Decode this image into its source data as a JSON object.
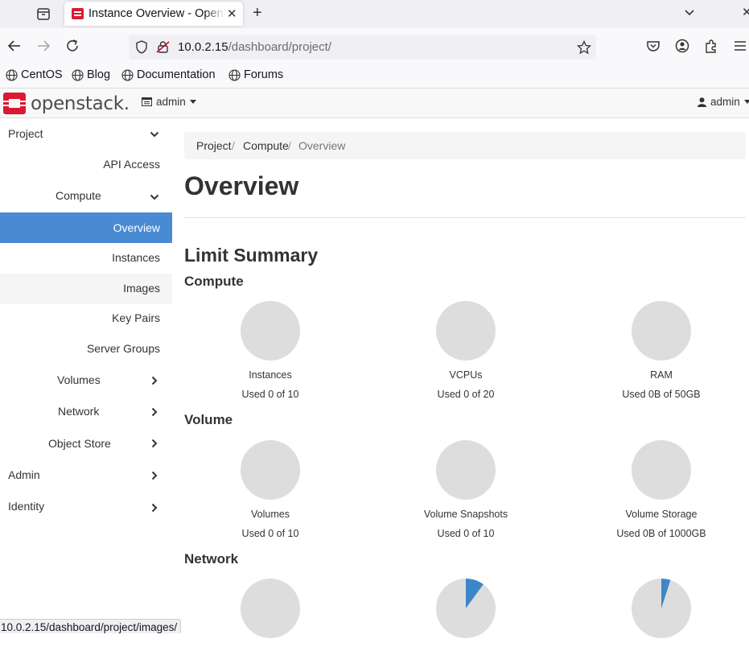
{
  "browser": {
    "tab_title": "Instance Overview - OpenStack Dashboard",
    "url_host": "10.0.2.15",
    "url_path": "/dashboard/project/",
    "bookmarks": [
      "CentOS",
      "Blog",
      "Documentation",
      "Forums"
    ],
    "status_url": "10.0.2.15/dashboard/project/images/"
  },
  "header": {
    "logo_text": "openstack.",
    "project": "admin",
    "user": "admin",
    "brand_color": "#da1a32"
  },
  "sidebar": {
    "project": "Project",
    "api_access": "API Access",
    "compute": "Compute",
    "overview": "Overview",
    "instances": "Instances",
    "images": "Images",
    "key_pairs": "Key Pairs",
    "server_groups": "Server Groups",
    "volumes": "Volumes",
    "network": "Network",
    "object_store": "Object Store",
    "admin": "Admin",
    "identity": "Identity",
    "active_color": "#4a8ad3"
  },
  "breadcrumb": [
    "Project",
    "Compute",
    "Overview"
  ],
  "page_title": "Overview",
  "limit_summary": "Limit Summary",
  "sections": {
    "compute": {
      "title": "Compute",
      "charts": [
        {
          "title": "Instances",
          "usage": "Used 0 of 10",
          "used": 0,
          "total": 10
        },
        {
          "title": "VCPUs",
          "usage": "Used 0 of 20",
          "used": 0,
          "total": 20
        },
        {
          "title": "RAM",
          "usage": "Used 0B of 50GB",
          "used": 0,
          "total": 50
        }
      ]
    },
    "volume": {
      "title": "Volume",
      "charts": [
        {
          "title": "Volumes",
          "usage": "Used 0 of 10",
          "used": 0,
          "total": 10
        },
        {
          "title": "Volume Snapshots",
          "usage": "Used 0 of 10",
          "used": 0,
          "total": 10
        },
        {
          "title": "Volume Storage",
          "usage": "Used 0B of 1000GB",
          "used": 0,
          "total": 1000
        }
      ]
    },
    "network": {
      "title": "Network",
      "charts": [
        {
          "title": "",
          "usage": "",
          "used": 0,
          "total": 1
        },
        {
          "title": "",
          "usage": "",
          "used": 1,
          "total": 10
        },
        {
          "title": "",
          "usage": "",
          "used": 5,
          "total": 100
        }
      ]
    }
  },
  "colors": {
    "pie_empty": "#dddddd",
    "pie_used": "#3d87c9"
  }
}
